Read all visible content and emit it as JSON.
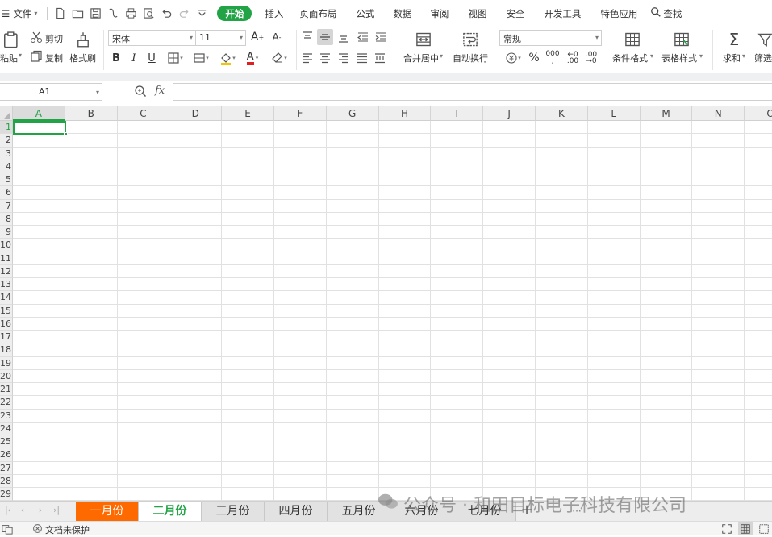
{
  "menubar": {
    "file_label": "文件",
    "tabs": [
      "开始",
      "插入",
      "页面布局",
      "公式",
      "数据",
      "审阅",
      "视图",
      "安全",
      "开发工具",
      "特色应用"
    ],
    "search_label": "查找"
  },
  "ribbon": {
    "paste_label": "粘贴",
    "cut_label": "剪切",
    "copy_label": "复制",
    "format_painter_label": "格式刷",
    "font_name": "宋体",
    "font_size": "11",
    "bold": "B",
    "italic": "I",
    "underline": "U",
    "merge_label": "合并居中",
    "wrap_label": "自动换行",
    "number_format": "常规",
    "percent": "%",
    "cond_format_label": "条件格式",
    "table_style_label": "表格样式",
    "sum_label": "求和",
    "filter_label": "筛选"
  },
  "formula_bar": {
    "cell_ref": "A1",
    "fx": "fx",
    "value": ""
  },
  "grid": {
    "columns": [
      "A",
      "B",
      "C",
      "D",
      "E",
      "F",
      "G",
      "H",
      "I",
      "J",
      "K",
      "L",
      "M",
      "N",
      "O"
    ],
    "rows": [
      "1",
      "2",
      "3",
      "4",
      "5",
      "6",
      "7",
      "8",
      "9",
      "10",
      "11",
      "12",
      "13",
      "14",
      "15",
      "16",
      "17",
      "18",
      "19",
      "20",
      "21",
      "22",
      "23",
      "24",
      "25",
      "26",
      "27",
      "28",
      "29"
    ],
    "active_cell": "A1"
  },
  "sheets": [
    "一月份",
    "二月份",
    "三月份",
    "四月份",
    "五月份",
    "六月份",
    "七月份"
  ],
  "active_sheet": "二月份",
  "watermark": "公众号 · 和田目标电子科技有限公司",
  "status": {
    "protection_label": "文档未保护"
  },
  "colors": {
    "accent": "#21a346",
    "first_tab": "#ff6a00"
  }
}
